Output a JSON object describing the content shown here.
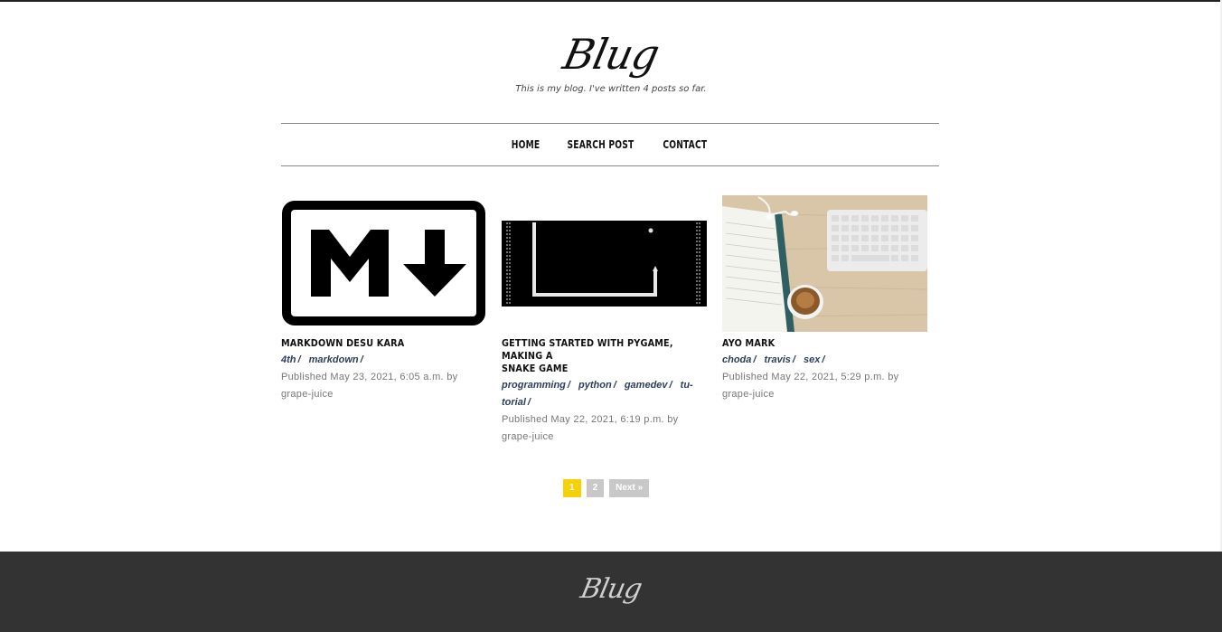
{
  "site": {
    "logo": "Blug",
    "tagline": "This is my blog. I've written 4 posts so far."
  },
  "nav": {
    "items": [
      "HOME",
      "SEARCH POST",
      "CONTACT"
    ]
  },
  "posts": [
    {
      "title": "MARKDOWN DESU KARA",
      "tags": [
        "4th",
        "markdown"
      ],
      "meta_line1": "Published May 23, 2021, 6:05 a.m. by",
      "meta_line2": "grape-juice",
      "thumbnail": "markdown-logo"
    },
    {
      "title_line1": "GETTING STARTED WITH PYGAME, MAKING A",
      "title_line2": "SNAKE GAME",
      "tags": [
        "programming",
        "python",
        "gamedev",
        "tu-",
        "torial"
      ],
      "meta_line1": "Published May 22, 2021, 6:19 p.m. by",
      "meta_line2": "grape-juice",
      "thumbnail": "snake-game-screenshot"
    },
    {
      "title": "AYO MARK",
      "tags": [
        "choda",
        "travis",
        "sex"
      ],
      "meta_line1": "Published May 22, 2021, 5:29 p.m. by",
      "meta_line2": "grape-juice",
      "thumbnail": "desk-photo"
    }
  ],
  "pagination": {
    "pages": [
      "1",
      "2"
    ],
    "next": "Next »",
    "active": "1"
  },
  "footer": {
    "logo": "Blug"
  },
  "colors": {
    "accent": "#f5d10a",
    "footer_bg": "#333333",
    "tag": "#2d3e5a"
  }
}
